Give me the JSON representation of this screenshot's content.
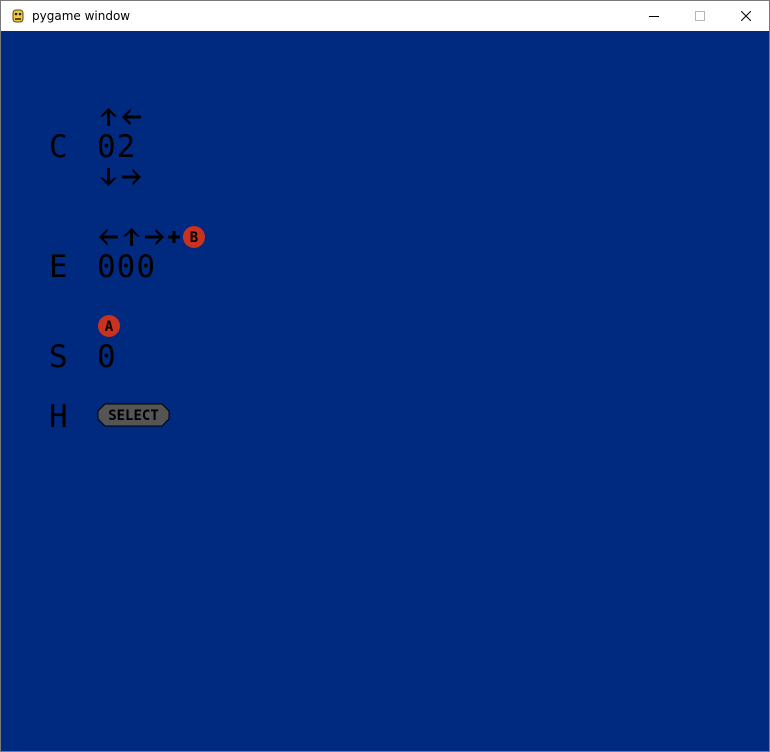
{
  "window": {
    "title": "pygame window"
  },
  "colors": {
    "background": "#002980",
    "glyph": "#000000",
    "button_red": "#c8321e",
    "select_gray": "#555555"
  },
  "rows": [
    {
      "letter": "C",
      "value": "02",
      "hint_above": [
        "arrow-up",
        "arrow-left"
      ],
      "hint_below": [
        "arrow-down",
        "arrow-right"
      ]
    },
    {
      "letter": "E",
      "value": "000",
      "hint_above": [
        "arrow-left",
        "arrow-up",
        "arrow-right",
        "plus",
        "button-b"
      ]
    },
    {
      "letter": "S",
      "value": "0",
      "hint_above": [
        "button-a"
      ]
    },
    {
      "letter": "H",
      "hint_inline": "select-button"
    }
  ],
  "button_labels": {
    "a": "A",
    "b": "B",
    "select": "SELECT"
  }
}
